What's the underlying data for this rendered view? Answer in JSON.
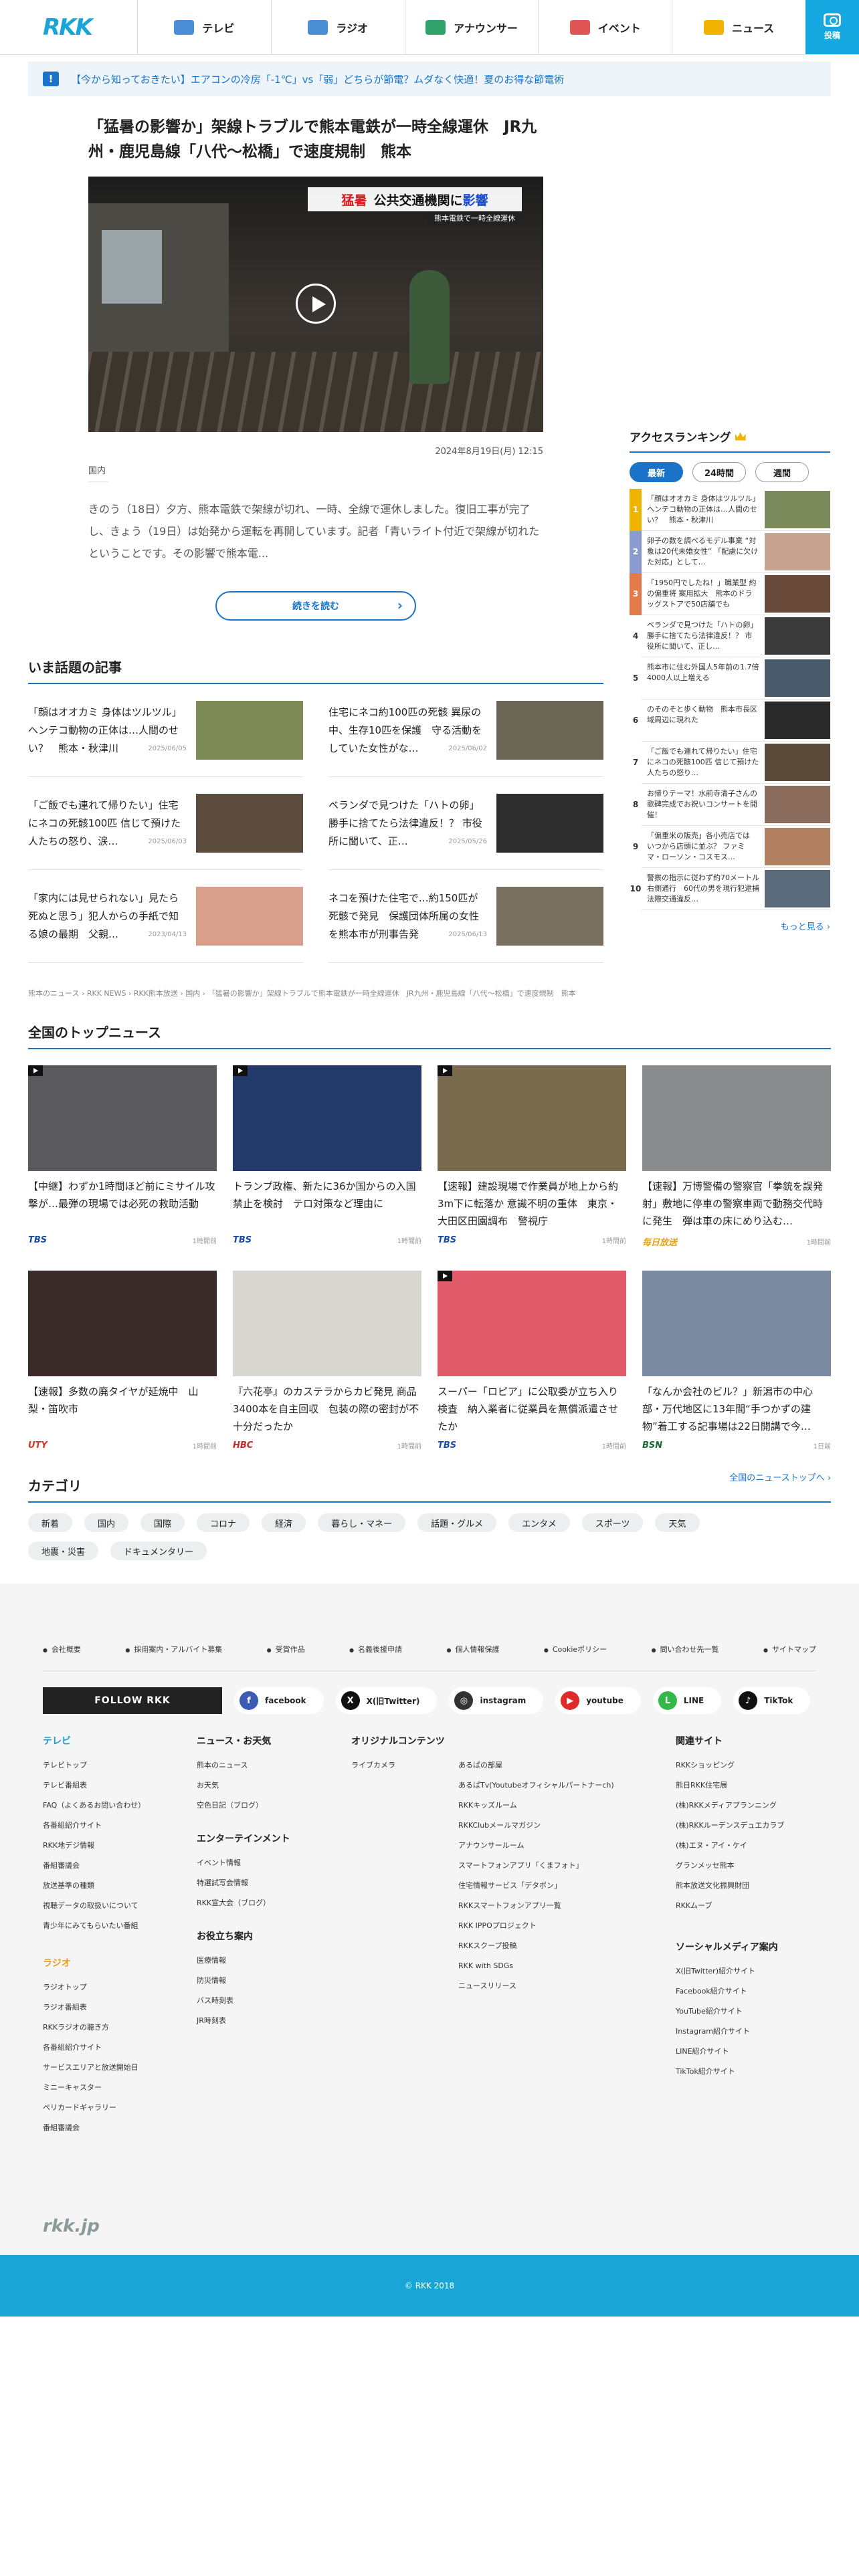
{
  "header": {
    "logo": "RKK",
    "nav": [
      {
        "label": "テレビ",
        "color": "#4a8fd6"
      },
      {
        "label": "ラジオ",
        "color": "#4a8fd6"
      },
      {
        "label": "アナウンサー",
        "color": "#2fa36b"
      },
      {
        "label": "イベント",
        "color": "#e05656"
      },
      {
        "label": "ニュース",
        "color": "#f0b400"
      }
    ],
    "post_label": "投稿"
  },
  "notice": {
    "icon": "!",
    "text": "【今から知っておきたい】エアコンの冷房「-1℃」vs「弱」どちらが節電？ムダなく快適！夏のお得な節電術"
  },
  "article": {
    "headline": "「猛暑の影響か」架線トラブルで熊本電鉄が一時全線運休　JR九州・鹿児島線「八代〜松橋」で速度規制　熊本",
    "telop_red": "猛暑",
    "telop_text": "公共交通機関に",
    "telop_blue": "影響",
    "subtelop": "熊本電鉄で一時全線運休",
    "date": "2024年8月19日(月) 12:15",
    "category": "国内",
    "lead": "きのう（18日）夕方、熊本電鉄で架線が切れ、一時、全線で運休しました。復旧工事が完了し、きょう（19日）は始発から運転を再開しています。記者「青いライト付近で架線が切れたということです。その影響で熊本電...",
    "more_label": "続きを読む"
  },
  "ranking": {
    "title": "アクセスランキング",
    "tabs": [
      "最新",
      "24時間",
      "週間"
    ],
    "items": [
      {
        "num": "1",
        "text": "「顔はオオカミ 身体はツルツル」ヘンテコ動物の正体は…人間のせい？　熊本・秋津川",
        "color": "#f0b400",
        "thumb": "#7a8a5a"
      },
      {
        "num": "2",
        "text": "卵子の数を調べるモデル事業 “対象は20代未婚女性” 「配慮に欠けた対応」として…",
        "color": "#8a9ccf",
        "thumb": "#c7a48f"
      },
      {
        "num": "3",
        "text": "「1950円でしたね！」職業型 約の偏重将 案用拡大　熊本のドラッグストアで50店舗でも",
        "color": "#e27a4a",
        "thumb": "#6a4a3a"
      },
      {
        "num": "4",
        "text": "ベランダで見つけた「ハトの卵」勝手に捨てたら法律違反！？ 市役所に聞いて、正し…",
        "color": "#ffffff",
        "thumb": "#3a3a3a"
      },
      {
        "num": "5",
        "text": "熊本市に住む外国人5年前の1.7倍　4000人以上増える",
        "color": "#ffffff",
        "thumb": "#4a5a6a"
      },
      {
        "num": "6",
        "text": "のそのそと歩く動物　熊本市長区域周辺に現れた",
        "color": "#ffffff",
        "thumb": "#2a2a2a"
      },
      {
        "num": "7",
        "text": "「ご飯でも連れて帰りたい」住宅にネコの死骸100匹 信じて預けた人たちの怒り…",
        "color": "#ffffff",
        "thumb": "#5a4a3a"
      },
      {
        "num": "8",
        "text": "お帰りテーマ！水前寺清子さんの歌碑完成でお祝いコンサートを開催！",
        "color": "#ffffff",
        "thumb": "#8a6a5a"
      },
      {
        "num": "9",
        "text": "「偏重米の販売」各小売店では　いつから店頭に並ぶ？ ファミマ・ローソン・コスモス…",
        "color": "#ffffff",
        "thumb": "#b08060"
      },
      {
        "num": "10",
        "text": "警察の指示に従わず約70メートル右側通行　60代の男を現行犯逮捕　法際交通違反…",
        "color": "#ffffff",
        "thumb": "#5a6a7a"
      }
    ],
    "more_label": "もっと見る"
  },
  "topics": {
    "title": "いま話題の記事",
    "items": [
      {
        "text": "「顔はオオカミ 身体はツルツル」ヘンテコ動物の正体は…人間のせい？　熊本・秋津川",
        "date": "2025/06/05",
        "thumb": "#7d8a55"
      },
      {
        "text": "住宅にネコ約100匹の死骸 異尿の中、生存10匹を保護　守る活動をしていた女性がな…",
        "date": "2025/06/02",
        "thumb": "#6b6656"
      },
      {
        "text": "「ご飯でも連れて帰りたい」住宅にネコの死骸100匹 信じて預けた人たちの怒り、涙…",
        "date": "2025/06/03",
        "thumb": "#5c4c3e"
      },
      {
        "text": "ベランダで見つけた「ハトの卵」勝手に捨てたら法律違反！？ 市役所に聞いて、正…",
        "date": "2025/05/26",
        "thumb": "#2e2e2e"
      },
      {
        "text": "「家内には見せられない」見たら死ぬと思う」犯人からの手紙で知る娘の最期　父親…",
        "date": "2023/04/13",
        "thumb": "#d8a08a"
      },
      {
        "text": "ネコを預けた住宅で…約150匹が死骸で発見　保護団体所属の女性を熊本市が刑事告発",
        "date": "2025/06/13",
        "thumb": "#7a7060"
      }
    ]
  },
  "breadcrumb": "熊本のニュース › RKK NEWS › RKK熊本放送 › 国内 › 「猛暑の影響か」架線トラブルで熊本電鉄が一時全線運休　JR九州・鹿児島線「八代〜松橋」で速度規制　熊本",
  "national": {
    "title": "全国のトップニュース",
    "items": [
      {
        "title": "【中継】わずか1時間ほど前にミサイル攻撃が…最弾の現場では必死の救助活動",
        "src": "TBS",
        "src_color": "#1a4aa8",
        "time": "1時間前",
        "img": "#5a5a5e",
        "video": true
      },
      {
        "title": "トランプ政権、新たに36か国からの入国禁止を検討　テロ対策など理由に",
        "src": "TBS",
        "src_color": "#1a4aa8",
        "time": "1時間前",
        "img": "#243a6a",
        "video": true
      },
      {
        "title": "【速報】建設現場で作業員が地上から約3m下に転落か 意識不明の重体　東京・大田区田園調布　警視庁",
        "src": "TBS",
        "src_color": "#1a4aa8",
        "time": "1時間前",
        "img": "#7a6a4e",
        "video": true
      },
      {
        "title": "【速報】万博警備の警察官「拳銃を誤発射」敷地に停車の警察車両で動務交代時に発生　弾は車の床にめり込む…",
        "src": "毎日放送",
        "src_color": "#e8a11a",
        "time": "1時間前",
        "img": "#8a8c8e",
        "video": false
      },
      {
        "title": "【速報】多数の廃タイヤが延焼中　山梨・笛吹市",
        "src": "UTY",
        "src_color": "#d8342a",
        "time": "1時間前",
        "img": "#3a2a28",
        "video": false
      },
      {
        "title": "『六花亭』のカステラからカビ発見 商品3400本を自主回収　包装の際の密封が不十分だったか",
        "src": "HBC",
        "src_color": "#c8282a",
        "time": "1時間前",
        "img": "#d8d8d0",
        "video": false
      },
      {
        "title": "スーパー「ロピア」に公取委が立ち入り検査　納入業者に従業員を無償派遣させたか",
        "src": "TBS",
        "src_color": "#1a4aa8",
        "time": "1時間前",
        "img": "#e05a6a",
        "video": true
      },
      {
        "title": "「なんか会社のビル？」新潟市の中心部・万代地区に13年間“手つかずの建物”着工する記事場は22日開講で今…",
        "src": "BSN",
        "src_color": "#1a6a3a",
        "time": "1日前",
        "img": "#7a8aa0",
        "video": false
      }
    ],
    "more_label": "全国のニューストップへ"
  },
  "categories": {
    "title": "カテゴリ",
    "items": [
      "新着",
      "国内",
      "国際",
      "コロナ",
      "経済",
      "暮らし・マネー",
      "話題・グルメ",
      "エンタメ",
      "スポーツ",
      "天気",
      "地震・災害",
      "ドキュメンタリー"
    ]
  },
  "footer": {
    "links": [
      "会社概要",
      "採用案内・アルバイト募集",
      "受賞作品",
      "名義後援申請",
      "個人情報保護",
      "Cookieポリシー",
      "問い合わせ先一覧",
      "サイトマップ"
    ],
    "follow_label": "FOLLOW RKK",
    "sns": [
      {
        "label": "facebook",
        "icon": "f",
        "color": "#3b5bb5"
      },
      {
        "label": "X(旧Twitter)",
        "icon": "X",
        "color": "#111111"
      },
      {
        "label": "instagram",
        "icon": "◎",
        "color": "#333333"
      },
      {
        "label": "youtube",
        "icon": "▶",
        "color": "#e02a2a"
      },
      {
        "label": "LINE",
        "icon": "L",
        "color": "#35b84a"
      },
      {
        "label": "TikTok",
        "icon": "♪",
        "color": "#111111"
      }
    ],
    "col_tv": {
      "title": "テレビ",
      "links": [
        "テレビトップ",
        "テレビ番組表",
        "FAQ（よくあるお問い合わせ）",
        "各番組紹介サイト",
        "RKK地デジ情報",
        "番組審議会",
        "放送基準の種類",
        "視聴データの取扱いについて",
        "青少年にみてもらいたい番組"
      ]
    },
    "col_radio": {
      "title": "ラジオ",
      "links": [
        "ラジオトップ",
        "ラジオ番組表",
        "RKKラジオの聴き方",
        "各番組紹介サイト",
        "サービスエリアと放送開始日",
        "ミニーキャスター",
        "ペリカードギャラリー",
        "番組審議会"
      ]
    },
    "col_news": {
      "title": "ニュース・お天気",
      "links": [
        "熊本のニュース",
        "お天気",
        "空色日記（ブログ）"
      ]
    },
    "col_ent": {
      "title": "エンターテインメント",
      "links": [
        "イベント情報",
        "特選試写会情報",
        "RKK宣大会（ブログ）"
      ]
    },
    "col_help": {
      "title": "お役立ち案内",
      "links": [
        "医療情報",
        "防災情報",
        "バス時刻表",
        "JR時刻表"
      ]
    },
    "col_orig": {
      "title": "オリジナルコンテンツ",
      "links_a": [
        "ライブカメラ"
      ],
      "links_b": [
        "あるぱの部屋",
        "あるぱTv(Youtubeオフィシャルパートナーch)",
        "RKKキッズルーム",
        "RKKClubメールマガジン",
        "アナウンサールーム",
        "スマートフォンアプリ「くまフォト」",
        "住宅情報サービス「デタポン」",
        "RKKスマートフォンアプリ一覧",
        "RKK IPPOプロジェクト",
        "RKKスクープ投稿",
        "RKK with SDGs",
        "ニュースリリース"
      ]
    },
    "col_related": {
      "title": "関連サイト",
      "links": [
        "RKKショッピング",
        "熊日RKK住宅展",
        "(株)RKKメディアプランニング",
        "(株)RKKルーデンスデュエカラブ",
        "(株)エヌ・アイ・ケイ",
        "グランメッセ熊本",
        "熊本放送文化振興財団",
        "RKKムーブ"
      ]
    },
    "col_social": {
      "title": "ソーシャルメディア案内",
      "links": [
        "X(旧Twitter)紹介サイト",
        "Facebook紹介サイト",
        "YouTube紹介サイト",
        "Instagram紹介サイト",
        "LINE紹介サイト",
        "TikTok紹介サイト"
      ]
    },
    "site_label": "rkk.jp",
    "copyright": "© RKK 2018"
  }
}
